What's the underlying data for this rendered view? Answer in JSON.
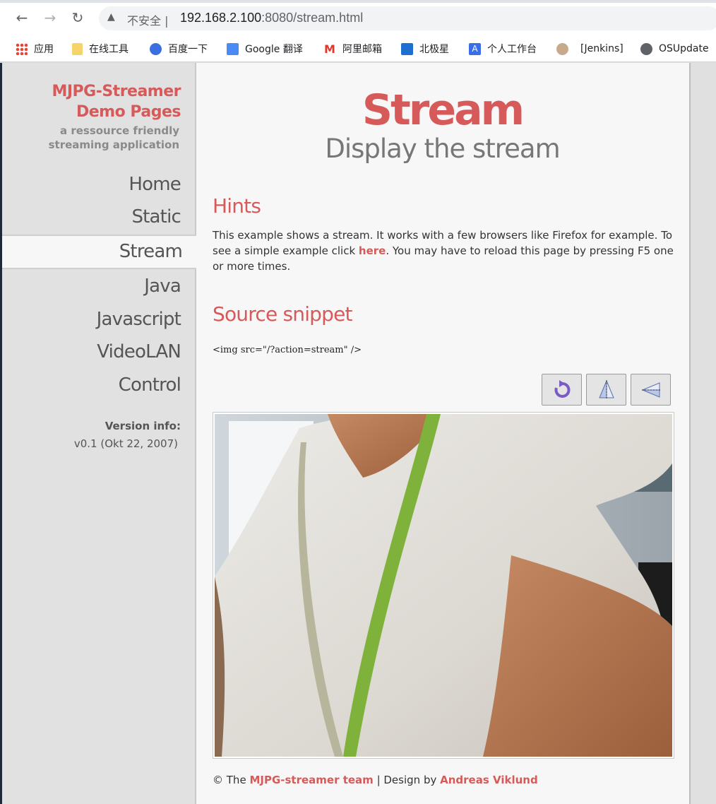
{
  "browser": {
    "insecure_label": "不安全",
    "url_host": "192.168.2.100",
    "url_rest": ":8080/stream.html",
    "bookmarks": [
      {
        "label": "应用",
        "icon": "apps-grid-icon"
      },
      {
        "label": "在线工具",
        "icon": "folder-icon"
      },
      {
        "label": "百度一下",
        "icon": "baidu-icon"
      },
      {
        "label": "Google 翻译",
        "icon": "google-translate-icon"
      },
      {
        "label": "阿里邮箱",
        "icon": "ali-mail-icon"
      },
      {
        "label": "北极星",
        "icon": "polaris-icon"
      },
      {
        "label": "个人工作台",
        "icon": "workbench-icon"
      },
      {
        "label": "[Jenkins]",
        "icon": "jenkins-icon"
      },
      {
        "label": "OSUpdate",
        "icon": "globe-icon"
      }
    ]
  },
  "sidebar": {
    "brand_line1": "MJPG-Streamer",
    "brand_line2": "Demo Pages",
    "tagline1": "a ressource friendly",
    "tagline2": "streaming application",
    "nav": [
      "Home",
      "Static",
      "Stream",
      "Java",
      "Javascript",
      "VideoLAN",
      "Control"
    ],
    "active": "Stream",
    "version_label": "Version info:",
    "version_value": "v0.1 (Okt 22, 2007)"
  },
  "main": {
    "title": "Stream",
    "subtitle": "Display the stream",
    "hints_heading": "Hints",
    "hints_text_1": "This example shows a stream. It works with a few browsers like Firefox for example. To see a simple example click ",
    "hints_link": "here",
    "hints_text_2": ". You may have to reload this page by pressing F5 one or more times.",
    "snippet_heading": "Source snippet",
    "snippet_code": "<img src=\"/?action=stream\" />",
    "toolbar": {
      "rotate_icon": "rotate-icon",
      "flip_vertical_icon": "flip-vertical-icon",
      "flip_horizontal_icon": "flip-horizontal-icon"
    }
  },
  "footer": {
    "prefix": "© The ",
    "team_link": "MJPG-streamer team",
    "middle": " | Design by ",
    "designer_link": "Andreas Viklund"
  },
  "colors": {
    "accent": "#d65a5a",
    "sidebar_bg": "#e1e1e1",
    "content_bg": "#f7f7f7"
  }
}
